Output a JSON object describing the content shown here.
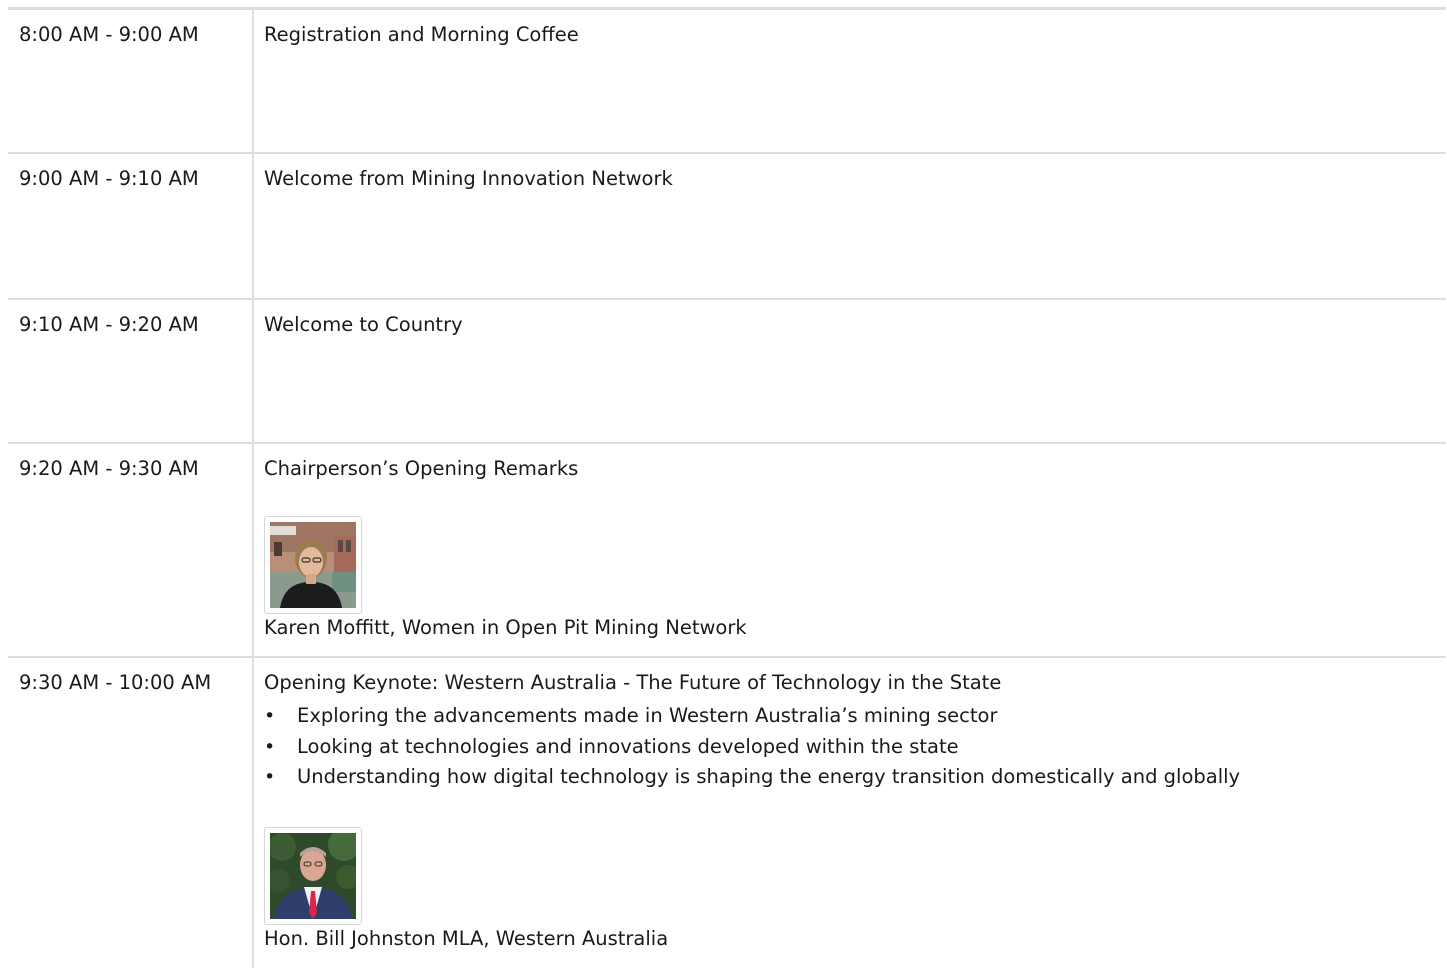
{
  "agenda": [
    {
      "time": "8:00 AM - 9:00 AM",
      "title": "Registration and Morning Coffee"
    },
    {
      "time": "9:00 AM - 9:10 AM",
      "title": "Welcome from Mining Innovation Network"
    },
    {
      "time": "9:10 AM - 9:20 AM",
      "title": "Welcome to Country"
    },
    {
      "time": "9:20 AM - 9:30 AM",
      "title": "Chairperson’s Opening Remarks",
      "speaker": {
        "name": "Karen Moffitt, Women in Open Pit Mining Network"
      }
    },
    {
      "time": "9:30 AM - 10:00 AM",
      "title": "Opening Keynote: Western Australia - The Future of Technology in the State",
      "points": [
        "Exploring the advancements made in Western Australia’s mining sector",
        "Looking at technologies and innovations developed within the state",
        "Understanding how digital technology is shaping the energy transition domestically and globally"
      ],
      "speaker": {
        "name": "Hon. Bill Johnston MLA, Western Australia"
      }
    }
  ],
  "bullet_glyph": "•"
}
